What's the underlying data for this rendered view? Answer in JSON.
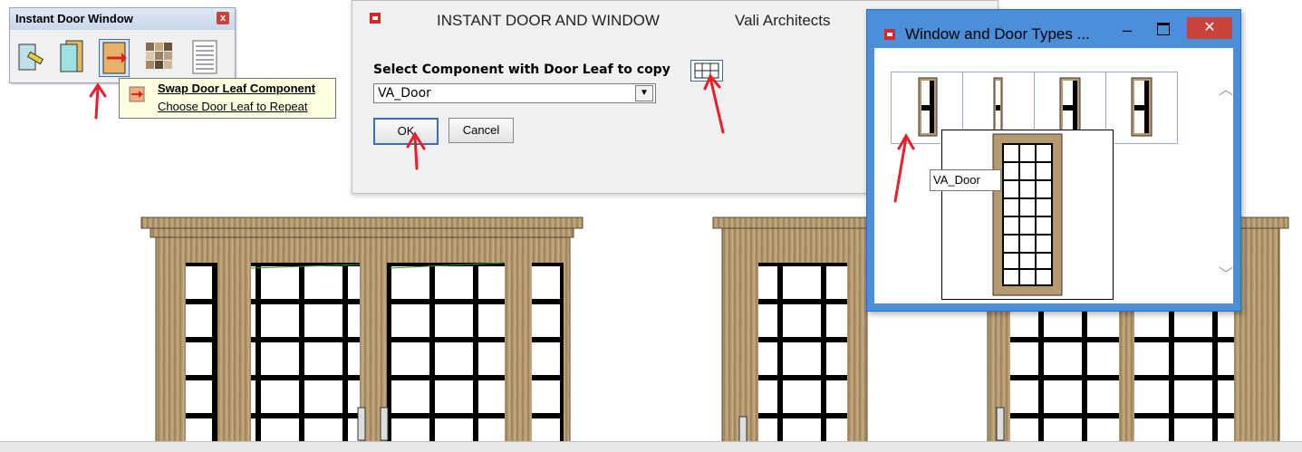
{
  "toolbar": {
    "title": "Instant Door Window",
    "close_label": "x"
  },
  "tooltip": {
    "title": "Swap Door Leaf Component",
    "subtitle": "Choose Door Leaf to Repeat"
  },
  "dialog": {
    "title": "INSTANT DOOR AND WINDOW",
    "publisher": "Vali Architects",
    "prompt": "Select Component with Door Leaf to copy",
    "selected_component": "VA_Door",
    "ok_label": "OK",
    "cancel_label": "Cancel"
  },
  "types_window": {
    "title": "Window and Door Types ...",
    "minimize_label": "–",
    "close_label": "✕",
    "hover_tooltip": "VA_Door",
    "scroll_up": "︿",
    "scroll_down": "﹀"
  },
  "colors": {
    "wood": "#b49a6e",
    "wood_dark": "#7a6440",
    "annotation_red": "#e8202a",
    "window_blue": "#4b8fd9"
  }
}
